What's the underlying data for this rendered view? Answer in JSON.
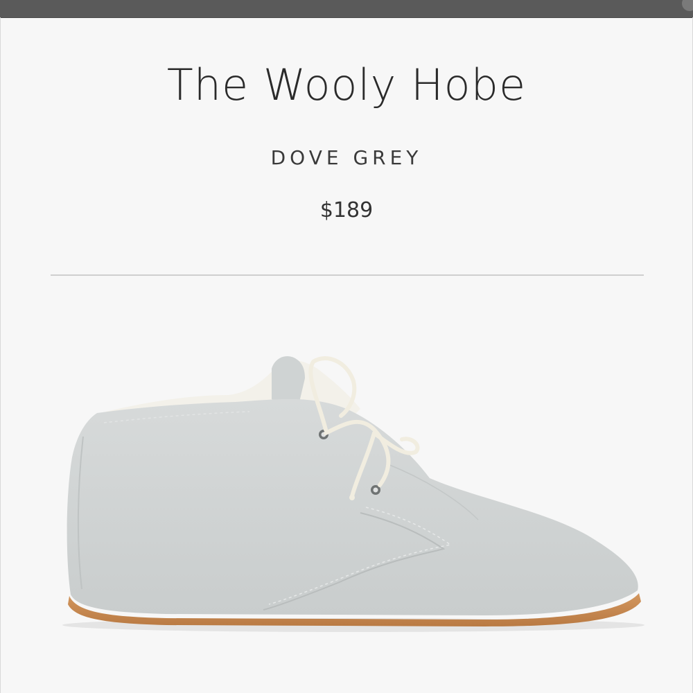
{
  "product": {
    "title": "The Wooly Hobe",
    "color_name": "DOVE GREY",
    "price": "$189"
  },
  "image": {
    "subject": "grey-suede-chukka-shoe",
    "colors": {
      "suede": "#cfd3d3",
      "sole": "#c4874f",
      "laces": "#f1ede0",
      "shearling": "#f4f2ec"
    }
  },
  "colors": {
    "background": "#f7f7f7",
    "top_bar": "#5a5a5a",
    "text": "#2a2a2a",
    "divider": "#cfcfcf"
  }
}
